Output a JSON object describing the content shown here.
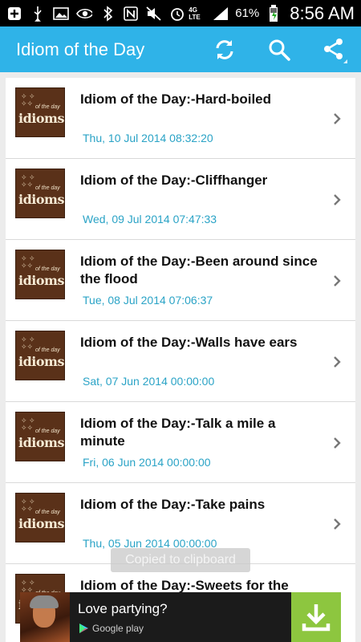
{
  "status_bar": {
    "battery_percent": "61%",
    "time": "8:56 AM",
    "network": "4G LTE",
    "icons": [
      "add-icon",
      "usb-icon",
      "image-icon",
      "eye-icon",
      "bluetooth-icon",
      "nfc-icon",
      "mute-icon",
      "alarm-icon",
      "signal-icon",
      "battery-icon"
    ]
  },
  "app_bar": {
    "title": "Idiom of the Day",
    "actions": [
      "refresh-icon",
      "search-icon",
      "share-icon"
    ]
  },
  "thumbnail": {
    "small_text": "of the day",
    "big_text": "idioms"
  },
  "items": [
    {
      "title": "Idiom of the Day:-Hard-boiled",
      "date": "Thu, 10 Jul 2014 08:32:20"
    },
    {
      "title": "Idiom of the Day:-Cliffhanger",
      "date": "Wed, 09 Jul 2014 07:47:33"
    },
    {
      "title": "Idiom of the Day:-Been around since the flood",
      "date": "Tue, 08 Jul 2014 07:06:37"
    },
    {
      "title": "Idiom of the Day:-Walls have ears",
      "date": "Sat, 07 Jun 2014 00:00:00"
    },
    {
      "title": "Idiom of the Day:-Talk a mile a minute",
      "date": "Fri, 06 Jun 2014 00:00:00"
    },
    {
      "title": "Idiom of the Day:-Take pains",
      "date": "Thu, 05 Jun 2014 00:00:00"
    },
    {
      "title": "Idiom of the Day:-Sweets for the",
      "date": ""
    }
  ],
  "toast": "Copied to clipboard",
  "ad": {
    "headline": "Love partying?",
    "store_label": "Google play"
  },
  "colors": {
    "app_bar": "#2fb3e8",
    "date_text": "#2aa3c6",
    "download_button": "#8dc63f"
  }
}
